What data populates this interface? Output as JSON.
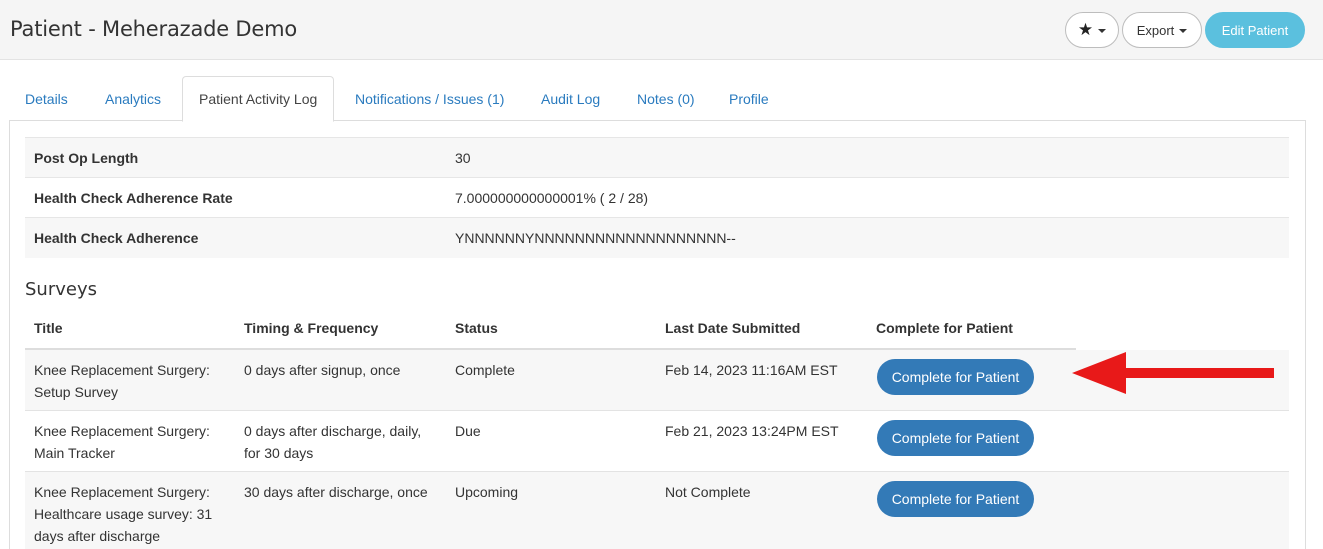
{
  "header": {
    "title": "Patient - Meherazade Demo",
    "star_label": "★",
    "export_label": "Export",
    "edit_label": "Edit Patient"
  },
  "tabs": [
    {
      "label": "Details"
    },
    {
      "label": "Analytics"
    },
    {
      "label": "Patient Activity Log"
    },
    {
      "label": "Notifications / Issues (1)"
    },
    {
      "label": "Audit Log"
    },
    {
      "label": "Notes (0)"
    },
    {
      "label": "Profile"
    }
  ],
  "summary": [
    {
      "key": "Post Op Length",
      "value": "30"
    },
    {
      "key": "Health Check Adherence Rate",
      "value": "7.000000000000001% ( 2 / 28)"
    },
    {
      "key": "Health Check Adherence",
      "value": "YNNNNNNYNNNNNNNNNNNNNNNNNNN--"
    }
  ],
  "surveys": {
    "title": "Surveys",
    "columns": [
      "Title",
      "Timing & Frequency",
      "Status",
      "Last Date Submitted",
      "Complete for Patient"
    ],
    "rows": [
      {
        "title_line1": "Knee Replacement Surgery:",
        "title_line2": "Setup Survey",
        "title_line3": "",
        "timing_line1": "0 days after signup, once",
        "timing_line2": "",
        "status": "Complete",
        "last_submitted": "Feb 14, 2023 11:16AM EST",
        "action": "Complete for Patient"
      },
      {
        "title_line1": "Knee Replacement Surgery:",
        "title_line2": "Main Tracker",
        "title_line3": "",
        "timing_line1": "0 days after discharge, daily,",
        "timing_line2": "for 30 days",
        "status": "Due",
        "last_submitted": "Feb 21, 2023 13:24PM EST",
        "action": "Complete for Patient"
      },
      {
        "title_line1": "Knee Replacement Surgery:",
        "title_line2": "Healthcare usage survey: 31",
        "title_line3": "days after discharge",
        "timing_line1": "30 days after discharge, once",
        "timing_line2": "",
        "status": "Upcoming",
        "last_submitted": "Not Complete",
        "action": "Complete for Patient"
      }
    ]
  },
  "colors": {
    "link": "#2a7bbf",
    "primary_button": "#337ab7",
    "edit_button": "#5bc0de",
    "arrow": "#e81919"
  }
}
